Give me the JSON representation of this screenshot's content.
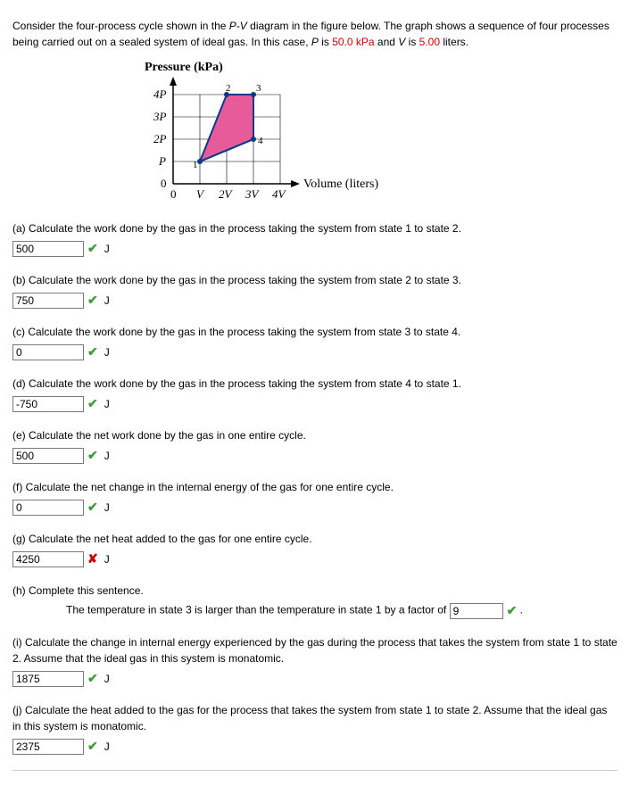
{
  "intro": {
    "part1": "Consider the four-process cycle shown in the ",
    "pv": "P-V",
    "part2": " diagram in the figure below. The graph shows a sequence of four processes being carried out on a sealed system of ideal gas. In this case, ",
    "p_sym": "P",
    "p_is": " is ",
    "p_val": "50.0 kPa",
    "and": " and ",
    "v_sym": "V",
    "v_is": " is ",
    "v_val": "5.00",
    "liters": " liters."
  },
  "diagram": {
    "y_label": "Pressure (kPa)",
    "x_label": "Volume (liters)",
    "y_ticks": [
      "4P",
      "3P",
      "2P",
      "P",
      "0"
    ],
    "x_ticks": [
      "0",
      "V",
      "2V",
      "3V",
      "4V"
    ],
    "points": [
      "1",
      "2",
      "3",
      "4"
    ]
  },
  "questions": {
    "a": {
      "text": "(a) Calculate the work done by the gas in the process taking the system from state 1 to state 2.",
      "value": "500",
      "unit": "J",
      "status": "check"
    },
    "b": {
      "text": "(b) Calculate the work done by the gas in the process taking the system from state 2 to state 3.",
      "value": "750",
      "unit": "J",
      "status": "check"
    },
    "c": {
      "text": "(c) Calculate the work done by the gas in the process taking the system from state 3 to state 4.",
      "value": "0",
      "unit": "J",
      "status": "check"
    },
    "d": {
      "text": "(d) Calculate the work done by the gas in the process taking the system from state 4 to state 1.",
      "value": "-750",
      "unit": "J",
      "status": "check"
    },
    "e": {
      "text": "(e) Calculate the net work done by the gas in one entire cycle.",
      "value": "500",
      "unit": "J",
      "status": "check"
    },
    "f": {
      "text": "(f) Calculate the net change in the internal energy of the gas for one entire cycle.",
      "value": "0",
      "unit": "J",
      "status": "check"
    },
    "g": {
      "text": "(g) Calculate the net heat added to the gas for one entire cycle.",
      "value": "4250",
      "unit": "J",
      "status": "cross"
    },
    "h": {
      "text": "(h) Complete this sentence.",
      "sentence_pre": "The temperature in state 3 is larger than the temperature in state 1 by a factor of ",
      "value": "9",
      "sentence_post": " .",
      "status": "check"
    },
    "i": {
      "text": "(i) Calculate the change in internal energy experienced by the gas during the process that takes the system from state 1 to state 2. Assume that the ideal gas in this system is monatomic.",
      "value": "1875",
      "unit": "J",
      "status": "check"
    },
    "j": {
      "text": "(j) Calculate the heat added to the gas for the process that takes the system from state 1 to state 2. Assume that the ideal gas in this system is monatomic.",
      "value": "2375",
      "unit": "J",
      "status": "check"
    }
  },
  "chart_data": {
    "type": "line",
    "title": "P-V Diagram — four-process cycle",
    "xlabel": "Volume (liters)",
    "ylabel": "Pressure (kPa)",
    "x_unit": "V (5.00 L)",
    "y_unit": "P (50.0 kPa)",
    "xlim": [
      0,
      4
    ],
    "ylim": [
      0,
      4
    ],
    "series": [
      {
        "name": "state 1",
        "x": 1,
        "y": 1
      },
      {
        "name": "state 2",
        "x": 2,
        "y": 4
      },
      {
        "name": "state 3",
        "x": 3,
        "y": 4
      },
      {
        "name": "state 4",
        "x": 3,
        "y": 2
      }
    ],
    "cycle_path": [
      [
        1,
        1
      ],
      [
        2,
        4
      ],
      [
        3,
        4
      ],
      [
        3,
        2
      ],
      [
        1,
        1
      ]
    ],
    "filled": true
  }
}
